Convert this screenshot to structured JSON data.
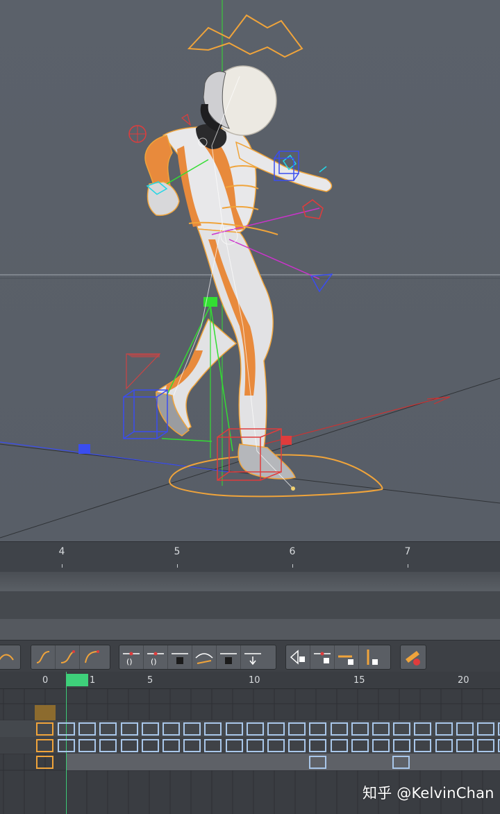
{
  "viewport": {
    "name": "3d-viewport",
    "colors": {
      "background": "#596069",
      "selection": "#f0a43b",
      "x_axis": "#e03c3c",
      "y_axis": "#33dd33",
      "z_axis": "#3a4df0"
    }
  },
  "timeline_ruler": {
    "ticks": [
      "4",
      "5",
      "6",
      "7"
    ]
  },
  "curve_toolbar": {
    "groups": [
      {
        "name": "interpolation",
        "buttons": [
          "spline-icon",
          "ease-in-icon",
          "ease-out-icon"
        ]
      },
      {
        "name": "tangents",
        "buttons": [
          "auto-tangent-icon",
          "zero-angle-icon",
          "zero-length-icon",
          "break-tangent-icon",
          "link-tangent-icon",
          "lock-tangent-icon"
        ]
      },
      {
        "name": "locks",
        "buttons": [
          "lock-key-icon",
          "lock-value-icon",
          "lock-time-icon",
          "lock-angle-icon"
        ]
      },
      {
        "name": "special",
        "buttons": [
          "clamp-icon"
        ]
      }
    ]
  },
  "dope_sheet": {
    "frame_labels": [
      "0",
      "1",
      "5",
      "10",
      "15",
      "20"
    ],
    "current_frame": 1,
    "playhead_color": "#3ed07a",
    "key_color": "#a9c7ea",
    "selected_key_color": "#f0a43b"
  },
  "watermark": {
    "text": "知乎 @KelvinChan"
  }
}
